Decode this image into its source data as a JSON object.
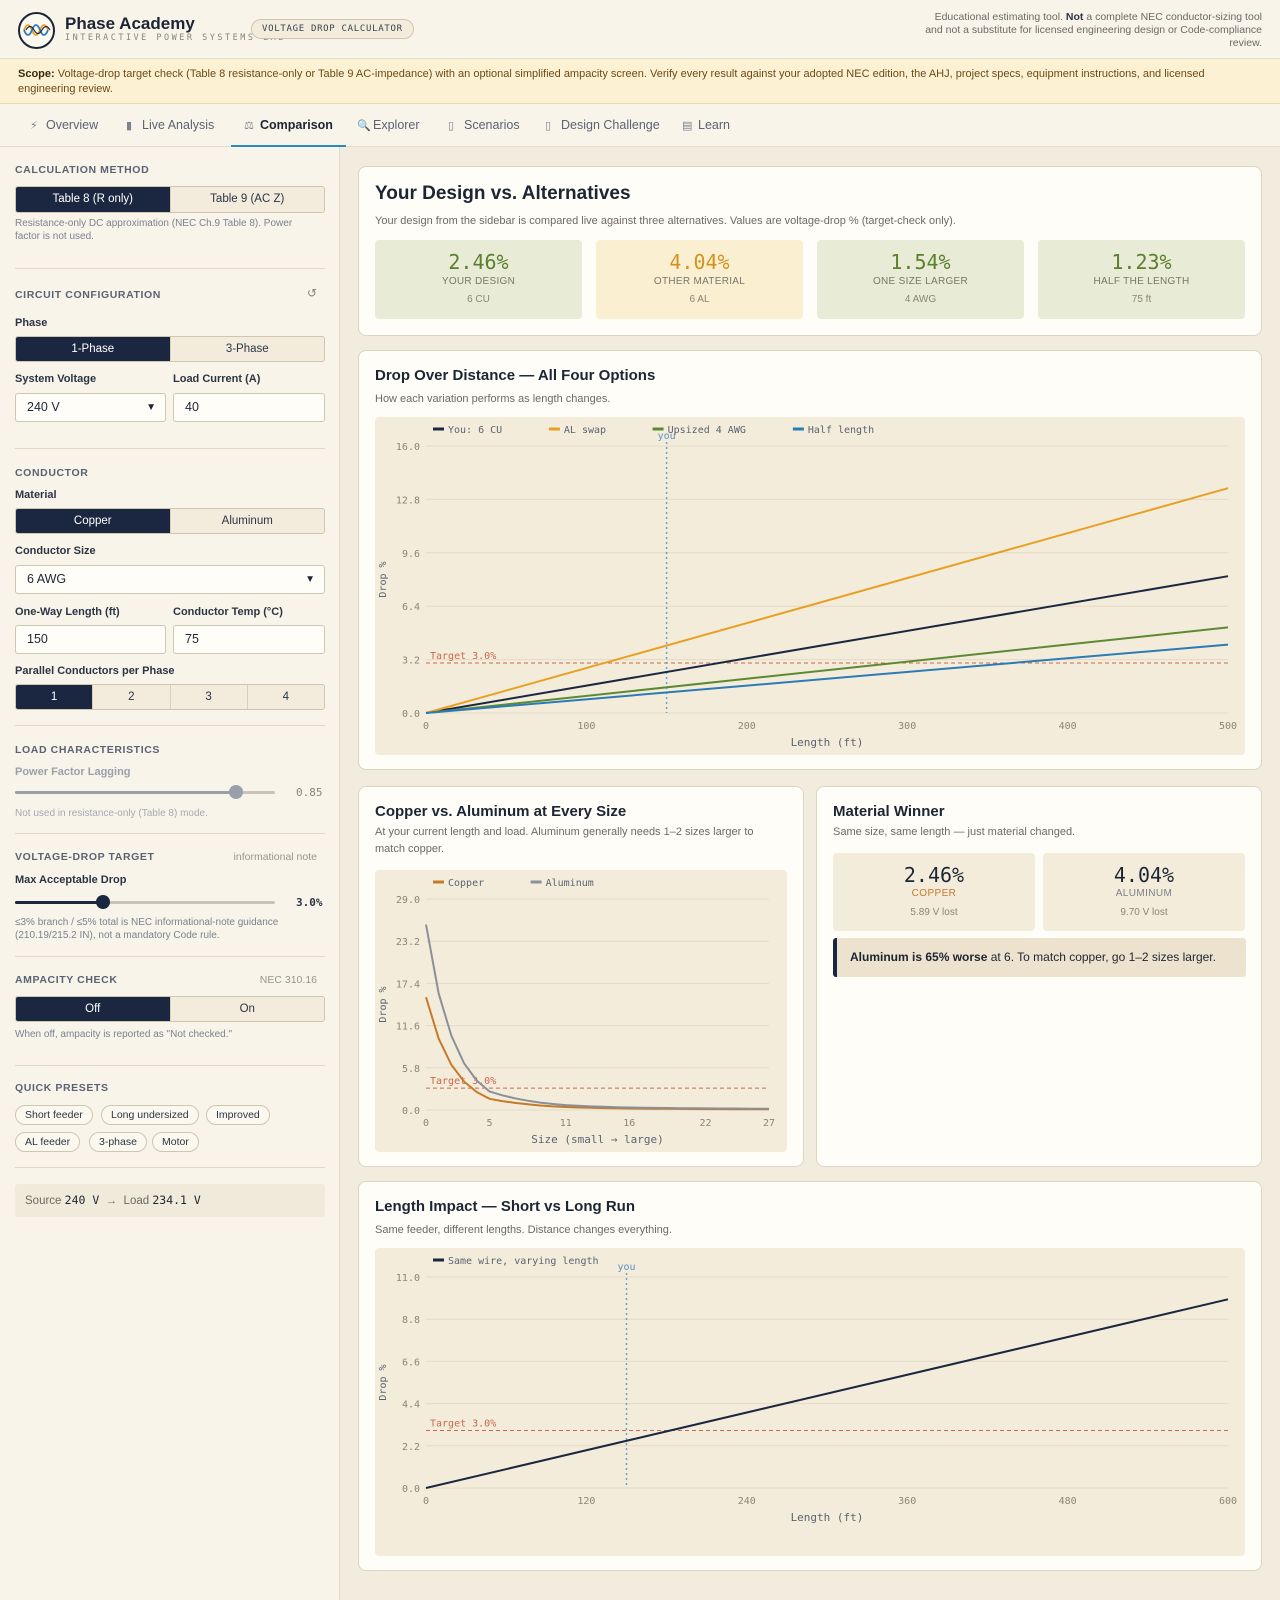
{
  "header": {
    "app_name": "Phase Academy",
    "app_tagline": "INTERACTIVE POWER SYSTEMS LAB",
    "tool_chip": "VOLTAGE DROP CALCULATOR",
    "disclaimer_pre": "Educational estimating tool. ",
    "disclaimer_bold": "Not",
    "disclaimer_post": " a complete NEC conductor-sizing tool and not a substitute for licensed engineering design or Code-compliance review."
  },
  "scope": {
    "label": "Scope:",
    "text": " Voltage-drop target check (Table 8 resistance-only or Table 9 AC-impedance) with an optional simplified ampacity screen. Verify every result against your adopted NEC edition, the AHJ, project specs, equipment instructions, and licensed engineering review."
  },
  "tabs": [
    {
      "label": "Overview",
      "icon": "bolt-icon",
      "glyph": "⚡"
    },
    {
      "label": "Live Analysis",
      "icon": "bar-chart-icon",
      "glyph": "▮"
    },
    {
      "label": "Comparison",
      "icon": "scales-icon",
      "glyph": "⚖"
    },
    {
      "label": "Explorer",
      "icon": "search-icon",
      "glyph": "🔍"
    },
    {
      "label": "Scenarios",
      "icon": "clipboard-icon",
      "glyph": "▯"
    },
    {
      "label": "Design Challenge",
      "icon": "target-icon",
      "glyph": "▯"
    },
    {
      "label": "Learn",
      "icon": "book-icon",
      "glyph": "▤"
    }
  ],
  "active_tab": "Comparison",
  "sidebar": {
    "calc_method": {
      "heading": "CALCULATION METHOD",
      "options": [
        "Table 8 (R only)",
        "Table 9 (AC Z)"
      ],
      "selected": "Table 8 (R only)",
      "help": "Resistance-only DC approximation (NEC Ch.9 Table 8). Power factor is not used."
    },
    "circuit": {
      "heading": "CIRCUIT CONFIGURATION",
      "reset_icon": "reset-icon",
      "reset_glyph": "↺",
      "phase_label": "Phase",
      "phase_options": [
        "1-Phase",
        "3-Phase"
      ],
      "phase_selected": "1-Phase",
      "voltage_label": "System Voltage",
      "voltage_value": "240 V",
      "current_label": "Load Current (A)",
      "current_value": "40"
    },
    "conductor": {
      "heading": "CONDUCTOR",
      "material_label": "Material",
      "material_options": [
        "Copper",
        "Aluminum"
      ],
      "material_selected": "Copper",
      "size_label": "Conductor Size",
      "size_value": "6 AWG",
      "length_label": "One-Way Length (ft)",
      "length_value": "150",
      "temp_label": "Conductor Temp (°C)",
      "temp_value": "75",
      "parallel_label": "Parallel Conductors per Phase",
      "parallel_options": [
        "1",
        "2",
        "3",
        "4"
      ],
      "parallel_selected": "1"
    },
    "load": {
      "heading": "LOAD CHARACTERISTICS",
      "pf_label": "Power Factor Lagging",
      "pf_value": "0.85",
      "pf_fraction": 0.85,
      "pf_help": "Not used in resistance-only (Table 8) mode."
    },
    "target": {
      "heading": "VOLTAGE-DROP TARGET",
      "note": "informational note",
      "max_label": "Max Acceptable Drop",
      "max_value": "3.0%",
      "max_fraction": 0.34,
      "help": "≤3% branch / ≤5% total is NEC informational-note guidance (210.19/215.2 IN), not a mandatory Code rule."
    },
    "ampacity": {
      "heading": "AMPACITY CHECK",
      "note": "NEC 310.16",
      "options": [
        "Off",
        "On"
      ],
      "selected": "Off",
      "help": "When off, ampacity is reported as \"Not checked.\""
    },
    "presets": {
      "heading": "QUICK PRESETS",
      "items": [
        "Short feeder",
        "Long undersized",
        "Improved",
        "AL feeder",
        "3-phase",
        "Motor"
      ]
    },
    "summary": {
      "source_label": "Source",
      "source_value": "240 V",
      "arrow": "→",
      "load_label": "Load",
      "load_value": "234.1 V"
    }
  },
  "comparison": {
    "title": "Your Design vs. Alternatives",
    "subtitle": "Your design from the sidebar is compared live against three alternatives. Values are voltage-drop % (target-check only).",
    "cards": [
      {
        "value": "2.46%",
        "name": "YOUR DESIGN",
        "sub": "6 CU",
        "color": "#5b7f2c",
        "bg": "#e8ebd5"
      },
      {
        "value": "4.04%",
        "name": "OTHER MATERIAL",
        "sub": "6 AL",
        "color": "#d3921d",
        "bg": "#fbefd2"
      },
      {
        "value": "1.54%",
        "name": "ONE SIZE LARGER",
        "sub": "4 AWG",
        "color": "#5b7f2c",
        "bg": "#e8ebd5"
      },
      {
        "value": "1.23%",
        "name": "HALF THE LENGTH",
        "sub": "75 ft",
        "color": "#5b7f2c",
        "bg": "#e8ebd5"
      }
    ]
  },
  "drop_chart": {
    "title": "Drop Over Distance — All Four Options",
    "subtitle": "How each variation performs as length changes."
  },
  "cu_al_chart": {
    "title": "Copper vs. Aluminum at Every Size",
    "subtitle": "At your current length and load. Aluminum generally needs 1–2 sizes larger to match copper."
  },
  "material_winner": {
    "title": "Material Winner",
    "subtitle": "Same size, same length — just material changed.",
    "copper": {
      "value": "2.46%",
      "name": "COPPER",
      "sub": "5.89 V lost",
      "color": "#c57a2a"
    },
    "aluminum": {
      "value": "4.04%",
      "name": "ALUMINUM",
      "sub": "9.70 V lost",
      "color": "#7a7f88"
    },
    "banner_bold": "Aluminum is 65% worse",
    "banner_rest": " at 6. To match copper, go 1–2 sizes larger."
  },
  "length_chart": {
    "title": "Length Impact — Short vs Long Run",
    "subtitle": "Same feeder, different lengths. Distance changes everything."
  },
  "chart_data": [
    {
      "type": "line",
      "xlabel": "Length (ft)",
      "ylabel": "Drop %",
      "xlim": [
        0,
        500
      ],
      "ylim": [
        0,
        16
      ],
      "xticks": [
        0,
        100,
        200,
        300,
        400,
        500
      ],
      "yticks": [
        "0.0",
        "3.2",
        "6.4",
        "9.6",
        "12.8",
        "16.0"
      ],
      "grid": true,
      "legend": "top-left",
      "target": {
        "value": 3.0,
        "label": "Target 3.0%"
      },
      "marker": {
        "x": 150,
        "label": "you"
      },
      "series": [
        {
          "name": "You: 6 CU",
          "color": "#1b2641",
          "x": [
            0,
            500
          ],
          "y": [
            0,
            8.2
          ]
        },
        {
          "name": "AL swap",
          "color": "#e8a024",
          "x": [
            0,
            500
          ],
          "y": [
            0,
            13.47
          ]
        },
        {
          "name": "Upsized 4 AWG",
          "color": "#5b8a32",
          "x": [
            0,
            500
          ],
          "y": [
            0,
            5.13
          ]
        },
        {
          "name": "Half length",
          "color": "#2a7bb6",
          "x": [
            0,
            500
          ],
          "y": [
            0,
            4.1
          ]
        }
      ]
    },
    {
      "type": "line",
      "xlabel": "Size (small → large)",
      "ylabel": "Drop %",
      "xlim": [
        0,
        27
      ],
      "ylim": [
        0,
        29
      ],
      "xticks": [
        0,
        5,
        11,
        16,
        22,
        27
      ],
      "yticks": [
        "0.0",
        "5.8",
        "11.6",
        "17.4",
        "23.2",
        "29.0"
      ],
      "grid": true,
      "legend": "top-left",
      "target": {
        "value": 3.0,
        "label": "Target 3.0%"
      },
      "series": [
        {
          "name": "Copper",
          "color": "#c57a2a",
          "x": [
            0,
            1,
            2,
            3,
            4,
            5,
            6,
            7,
            8,
            9,
            10,
            11,
            12,
            13,
            14,
            15,
            16,
            17,
            18,
            19,
            20,
            21,
            22,
            23,
            24,
            25,
            26,
            27
          ],
          "y": [
            15.5,
            9.8,
            6.2,
            3.9,
            2.46,
            1.54,
            1.23,
            0.98,
            0.78,
            0.62,
            0.5,
            0.41,
            0.35,
            0.3,
            0.26,
            0.23,
            0.21,
            0.19,
            0.17,
            0.16,
            0.15,
            0.14,
            0.13,
            0.12,
            0.115,
            0.11,
            0.105,
            0.1
          ]
        },
        {
          "name": "Aluminum",
          "color": "#8a8f99",
          "x": [
            0,
            1,
            2,
            3,
            4,
            5,
            6,
            7,
            8,
            9,
            10,
            11,
            12,
            13,
            14,
            15,
            16,
            17,
            18,
            19,
            20,
            21,
            22,
            23,
            24,
            25,
            26,
            27
          ],
          "y": [
            25.5,
            16.0,
            10.2,
            6.4,
            4.04,
            2.54,
            2.02,
            1.61,
            1.28,
            1.02,
            0.82,
            0.68,
            0.58,
            0.5,
            0.44,
            0.39,
            0.35,
            0.32,
            0.29,
            0.27,
            0.25,
            0.23,
            0.22,
            0.21,
            0.2,
            0.19,
            0.18,
            0.17
          ]
        }
      ]
    },
    {
      "type": "line",
      "xlabel": "Length (ft)",
      "ylabel": "Drop %",
      "xlim": [
        0,
        600
      ],
      "ylim": [
        0,
        11
      ],
      "xticks": [
        0,
        120,
        240,
        360,
        480,
        600
      ],
      "yticks": [
        "0.0",
        "2.2",
        "4.4",
        "6.6",
        "8.8",
        "11.0"
      ],
      "grid": true,
      "legend": "top-left",
      "target": {
        "value": 3.0,
        "label": "Target 3.0%"
      },
      "marker": {
        "x": 150,
        "label": "you"
      },
      "series": [
        {
          "name": "Same wire, varying length",
          "color": "#1b2641",
          "x": [
            0,
            600
          ],
          "y": [
            0,
            9.84
          ]
        }
      ]
    }
  ]
}
